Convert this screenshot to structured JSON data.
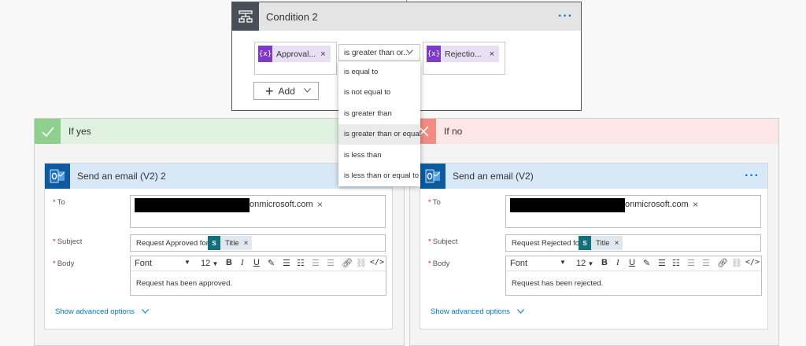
{
  "condition": {
    "title": "Condition 2",
    "more_label": "···",
    "left_token": "Approval...",
    "operator_selected": "is greater than or...",
    "right_token": "Rejectio...",
    "token_icon": "{x}",
    "token_remove": "×",
    "add_label": "Add",
    "operators": [
      "is equal to",
      "is not equal to",
      "is greater than",
      "is greater than or equal to",
      "is less than",
      "is less than or equal to"
    ]
  },
  "branches": {
    "yes": {
      "label": "If yes",
      "color": "#dff2df",
      "icon_color": "#8fd08f"
    },
    "no": {
      "label": "If no",
      "color": "#fde7e6",
      "icon_color": "#f28b82"
    }
  },
  "emails": [
    {
      "title": "Send an email (V2) 2",
      "to_label": "To",
      "to_value": "onmicrosoft.com",
      "subject_label": "Subject",
      "subject_text": "Request Approved for",
      "subject_token": "Title",
      "body_label": "Body",
      "font_label": "Font",
      "font_size": "12",
      "body_text": "Request has been approved.",
      "advanced_label": "Show advanced options"
    },
    {
      "title": "Send an email (V2)",
      "to_label": "To",
      "to_value": "onmicrosoft.com",
      "subject_label": "Subject",
      "subject_text": "Request Rejected for",
      "subject_token": "Title",
      "body_label": "Body",
      "font_label": "Font",
      "font_size": "12",
      "body_text": "Request has been rejected.",
      "advanced_label": "Show advanced options",
      "more_label": "···"
    }
  ],
  "colors": {
    "accent": "#0078d4",
    "token_purple": "#7d3bc6",
    "outlook_blue": "#0e5a9e",
    "sharepoint_teal": "#136f7c"
  }
}
